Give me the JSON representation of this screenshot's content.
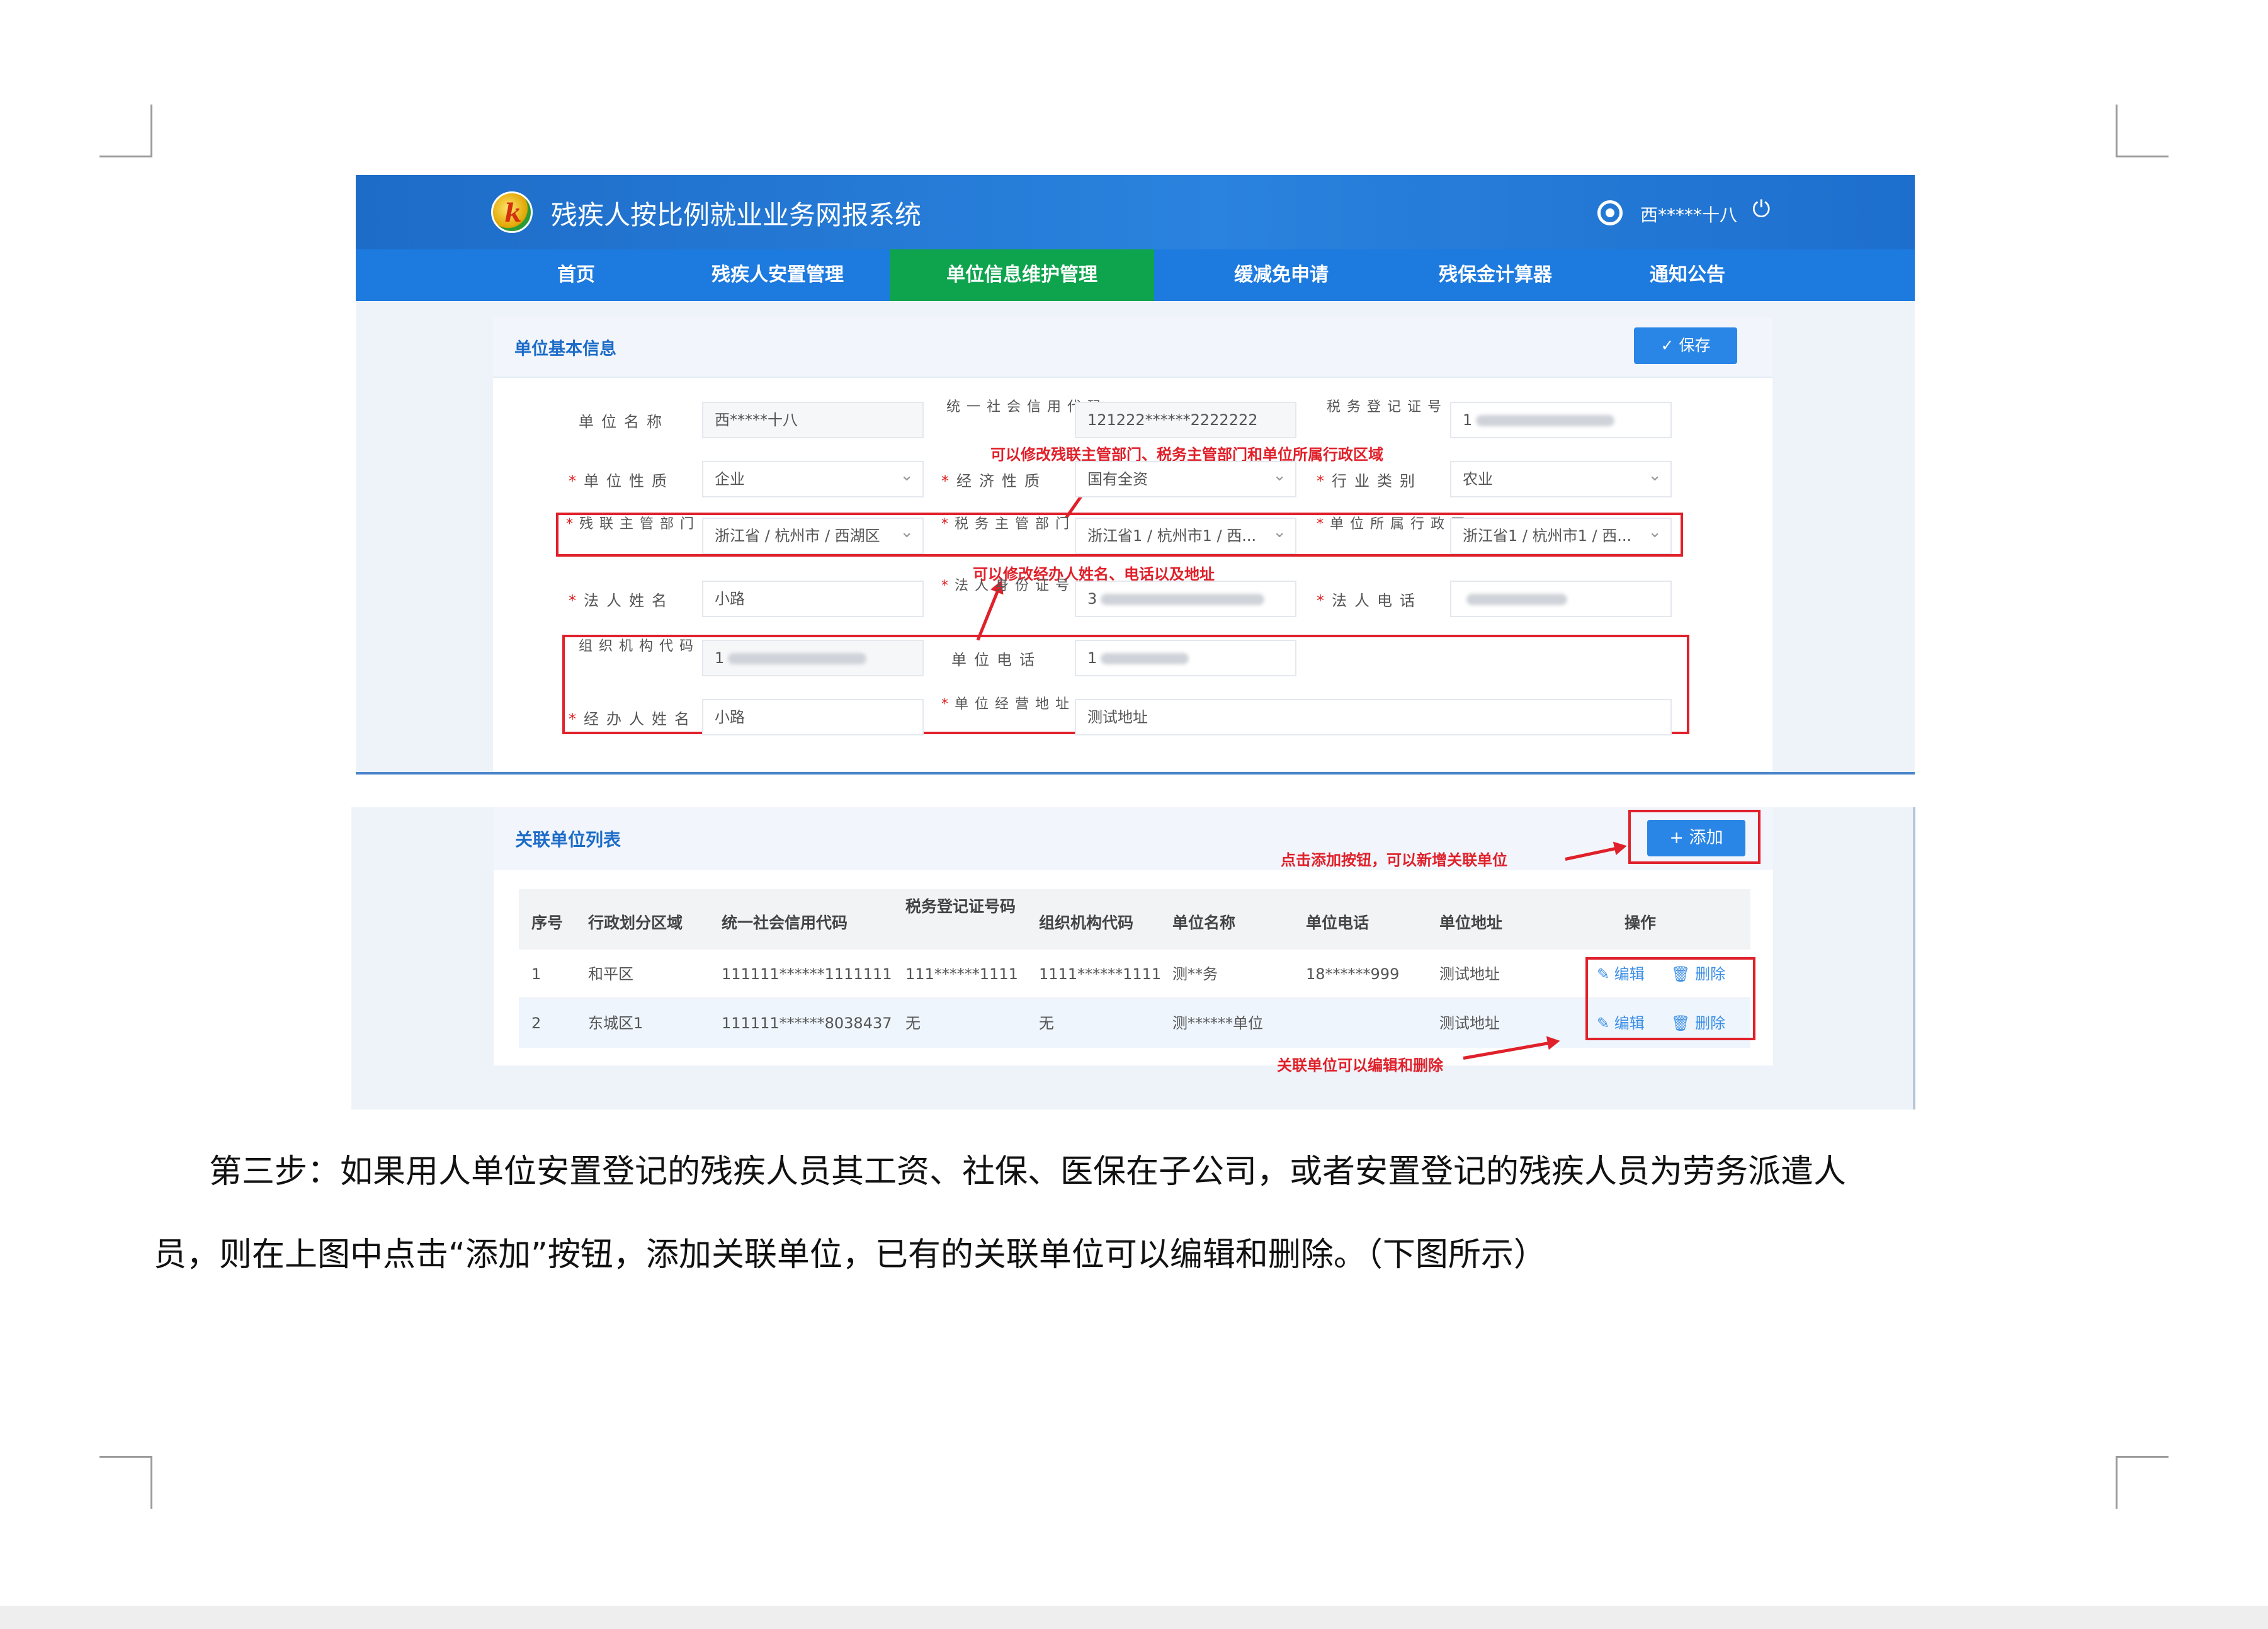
{
  "app": {
    "title": "残疾人按比例就业业务网报系统",
    "logo_mark": "k",
    "user": "西*****十八",
    "power_icon": "power-icon",
    "nav": [
      "首页",
      "残疾人安置管理",
      "单位信息维护管理",
      "缓减免申请",
      "残保金计算器",
      "通知公告"
    ],
    "active_nav": "单位信息维护管理"
  },
  "basic_info": {
    "title": "单位基本信息",
    "save_label": "✓ 保存",
    "fields": {
      "unit_name": {
        "label": "单位名称",
        "value": "西*****十八"
      },
      "credit_code": {
        "label": "统一社会信用代码",
        "value": "121222******2222222"
      },
      "tax_reg": {
        "label": "税务登记证号",
        "value": "1"
      },
      "unit_nature": {
        "label": "单位性质",
        "value": "企业"
      },
      "economic_nature": {
        "label": "经济性质",
        "value": "国有全资"
      },
      "industry": {
        "label": "行业类别",
        "value": "农业"
      },
      "dpf_dept": {
        "label": "残联主管部门",
        "value": "浙江省 / 杭州市 / 西湖区"
      },
      "tax_dept": {
        "label": "税务主管部门",
        "value": "浙江省1 / 杭州市1 / 西..."
      },
      "admin_area": {
        "label": "单位所属行政区",
        "value": "浙江省1 / 杭州市1 / 西..."
      },
      "legal_name": {
        "label": "法人姓名",
        "value": "小路"
      },
      "legal_id": {
        "label": "法人身份证号",
        "value": "3"
      },
      "legal_phone": {
        "label": "法人电话",
        "value": ""
      },
      "org_code": {
        "label": "组织机构代码",
        "value": "1"
      },
      "unit_phone": {
        "label": "单位电话",
        "value": "1"
      },
      "handler_name": {
        "label": "经办人姓名",
        "value": "小路"
      },
      "business_address": {
        "label": "单位经营地址",
        "value": "测试地址"
      }
    },
    "notes": {
      "note1": "可以修改残联主管部门、税务主管部门和单位所属行政区域",
      "note2": "可以修改经办人姓名、电话以及地址"
    }
  },
  "related_units": {
    "title": "关联单位列表",
    "add_label": "+ 添加",
    "note_add": "点击添加按钮，可以新增关联单位",
    "note_edit": "关联单位可以编辑和删除",
    "columns": [
      "序号",
      "行政划分区域",
      "统一社会信用代码",
      "税务登记证号码",
      "组织机构代码",
      "单位名称",
      "单位电话",
      "单位地址",
      "操作"
    ],
    "edit_label": "编辑",
    "delete_label": "删除",
    "rows": [
      [
        "1",
        "和平区",
        "111111******1111111",
        "111******1111",
        "1111******1111",
        "测**务",
        "18******999",
        "测试地址"
      ],
      [
        "2",
        "东城区1",
        "111111******8038437",
        "无",
        "无",
        "测******单位",
        "",
        "测试地址"
      ]
    ]
  },
  "body": {
    "line1": "第三步：如果用人单位安置登记的残疾人员其工资、社保、医保在子公司，或者安置登记的残疾人员为劳务派遣人",
    "line2": "员，则在上图中点击“添加”按钮，添加关联单位，已有的关联单位可以编辑和删除。（下图所示）"
  }
}
